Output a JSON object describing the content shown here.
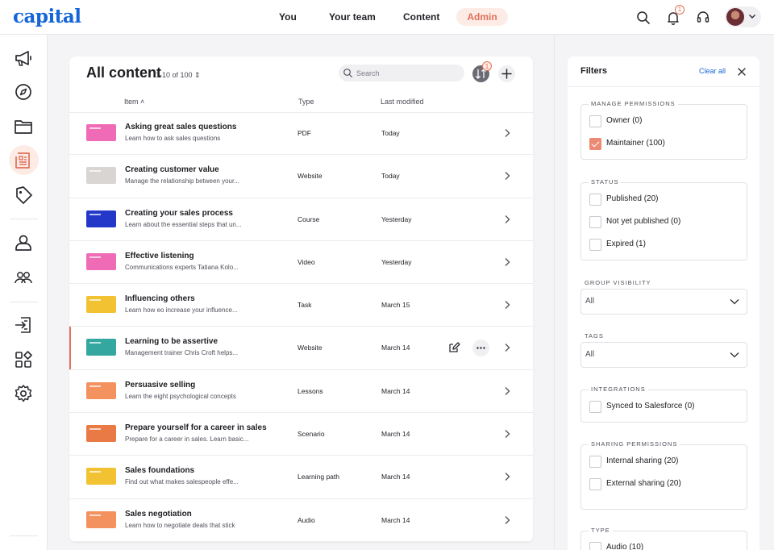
{
  "brand": {
    "logo": "capital",
    "accent": "#1565d8",
    "admin_accent": "#e0705a"
  },
  "topnav": {
    "items": [
      "You",
      "Your team",
      "Content"
    ],
    "admin": "Admin",
    "notification_count": "1"
  },
  "sidebar": {
    "icons": [
      "megaphone-icon",
      "compass-icon",
      "folders-icon",
      "document-icon",
      "tag-icon",
      "person-icon",
      "people-icon",
      "upload-icon",
      "widgets-icon",
      "gear-icon"
    ],
    "active": "document-icon"
  },
  "content": {
    "title": "All content",
    "count": "1-10 of 100",
    "search_placeholder": "Search",
    "sort_badge": "1",
    "columns": {
      "item": "Item",
      "type": "Type",
      "modified": "Last modified"
    },
    "rows": [
      {
        "title": "Asking great sales questions",
        "desc": "Learn how to ask sales questions",
        "type": "PDF",
        "date": "Today",
        "thumb": "#f06bb5"
      },
      {
        "title": "Creating customer value",
        "desc": "Manage the relationship between your...",
        "type": "Website",
        "date": "Today",
        "thumb": "#d9d5d2"
      },
      {
        "title": "Creating your sales process",
        "desc": "Learn about the essential steps that un...",
        "type": "Course",
        "date": "Yesterday",
        "thumb": "#2338c9"
      },
      {
        "title": "Effective listening",
        "desc": "Communications experts Tatiana Kolo...",
        "type": "Video",
        "date": "Yesterday",
        "thumb": "#f06bb5"
      },
      {
        "title": "Influencing others",
        "desc": "Learn how eo increase your influence...",
        "type": "Task",
        "date": "March 15",
        "thumb": "#f2c232"
      },
      {
        "title": "Learning to be assertive",
        "desc": "Management trainer Chris Croft helps...",
        "type": "Website",
        "date": "March 14",
        "thumb": "#34a7a0"
      },
      {
        "title": "Persuasive selling",
        "desc": "Learn the eight psychological concepts",
        "type": "Lessons",
        "date": "March 14",
        "thumb": "#f4925f"
      },
      {
        "title": "Prepare yourself for a career in sales",
        "desc": "Prepare for a career in sales. Learn basic...",
        "type": "Scenario",
        "date": "March 14",
        "thumb": "#ea7a45"
      },
      {
        "title": "Sales foundations",
        "desc": "Find out what makes salespeople effe...",
        "type": "Learning path",
        "date": "March 14",
        "thumb": "#f2c232"
      },
      {
        "title": "Sales negotiation",
        "desc": "Learn how to negotiate deals that stick",
        "type": "Audio",
        "date": "March 14",
        "thumb": "#f4925f"
      }
    ]
  },
  "filters": {
    "title": "Filters",
    "clear": "Clear all",
    "manage": {
      "legend": "MANAGE PERMISSIONS",
      "options": [
        {
          "label": "Owner (0)",
          "checked": false
        },
        {
          "label": "Maintainer (100)",
          "checked": true
        }
      ]
    },
    "status": {
      "legend": "STATUS",
      "options": [
        {
          "label": "Published (20)",
          "checked": false
        },
        {
          "label": "Not yet published (0)",
          "checked": false
        },
        {
          "label": "Expired (1)",
          "checked": false
        }
      ]
    },
    "group_visibility": {
      "legend": "GROUP VISIBILITY",
      "value": "All"
    },
    "tags": {
      "legend": "TAGS",
      "value": "All"
    },
    "integrations": {
      "legend": "INTEGRATIONS",
      "options": [
        {
          "label": "Synced to Salesforce (0)",
          "checked": false
        }
      ]
    },
    "sharing": {
      "legend": "SHARING PERMISSIONS",
      "options": [
        {
          "label": "Internal sharing (20)",
          "checked": false
        },
        {
          "label": "External sharing (20)",
          "checked": false
        }
      ]
    },
    "type": {
      "legend": "TYPE",
      "options": [
        {
          "label": "Audio (10)",
          "checked": false
        }
      ]
    }
  }
}
